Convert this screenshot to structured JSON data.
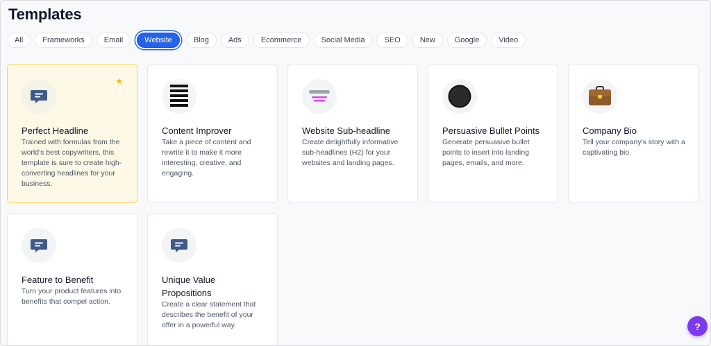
{
  "page": {
    "title": "Templates"
  },
  "filters": [
    {
      "label": "All",
      "active": false
    },
    {
      "label": "Frameworks",
      "active": false
    },
    {
      "label": "Email",
      "active": false
    },
    {
      "label": "Website",
      "active": true
    },
    {
      "label": "Blog",
      "active": false
    },
    {
      "label": "Ads",
      "active": false
    },
    {
      "label": "Ecommerce",
      "active": false
    },
    {
      "label": "Social Media",
      "active": false
    },
    {
      "label": "SEO",
      "active": false
    },
    {
      "label": "New",
      "active": false
    },
    {
      "label": "Google",
      "active": false
    },
    {
      "label": "Video",
      "active": false
    }
  ],
  "templates": [
    {
      "title": "Perfect Headline",
      "description": "Trained with formulas from the world's best copywriters, this template is sure to create high-converting headlines for your business.",
      "icon": "chat-bubble-icon",
      "featured": true
    },
    {
      "title": "Content Improver",
      "description": "Take a piece of content and rewrite it to make it more interesting, creative, and engaging.",
      "icon": "stacked-bars-icon",
      "featured": false
    },
    {
      "title": "Website Sub-headline",
      "description": "Create delightfully informative sub-headlines (H2) for your websites and landing pages.",
      "icon": "subheadline-lines-icon",
      "featured": false
    },
    {
      "title": "Persuasive Bullet Points",
      "description": "Generate persuasive bullet points to insert into landing pages, emails, and more.",
      "icon": "bullet-point-icon",
      "featured": false
    },
    {
      "title": "Company Bio",
      "description": "Tell your company's story with a captivating bio.",
      "icon": "briefcase-icon",
      "featured": false
    },
    {
      "title": "Feature to Benefit",
      "description": "Turn your product features into benefits that compel action.",
      "icon": "chat-bubble-icon",
      "featured": false
    },
    {
      "title": "Unique Value Propositions",
      "description": "Create a clear statement that describes the benefit of your offer in a powerful way.",
      "icon": "chat-bubble-icon",
      "featured": false,
      "two_line_title": true
    }
  ],
  "help": {
    "label": "?"
  },
  "colors": {
    "accent": "#2563eb",
    "featured_bg": "#fef9e7",
    "featured_border": "#fcd34d",
    "star": "#f5b800",
    "help": "#7c3aed"
  }
}
